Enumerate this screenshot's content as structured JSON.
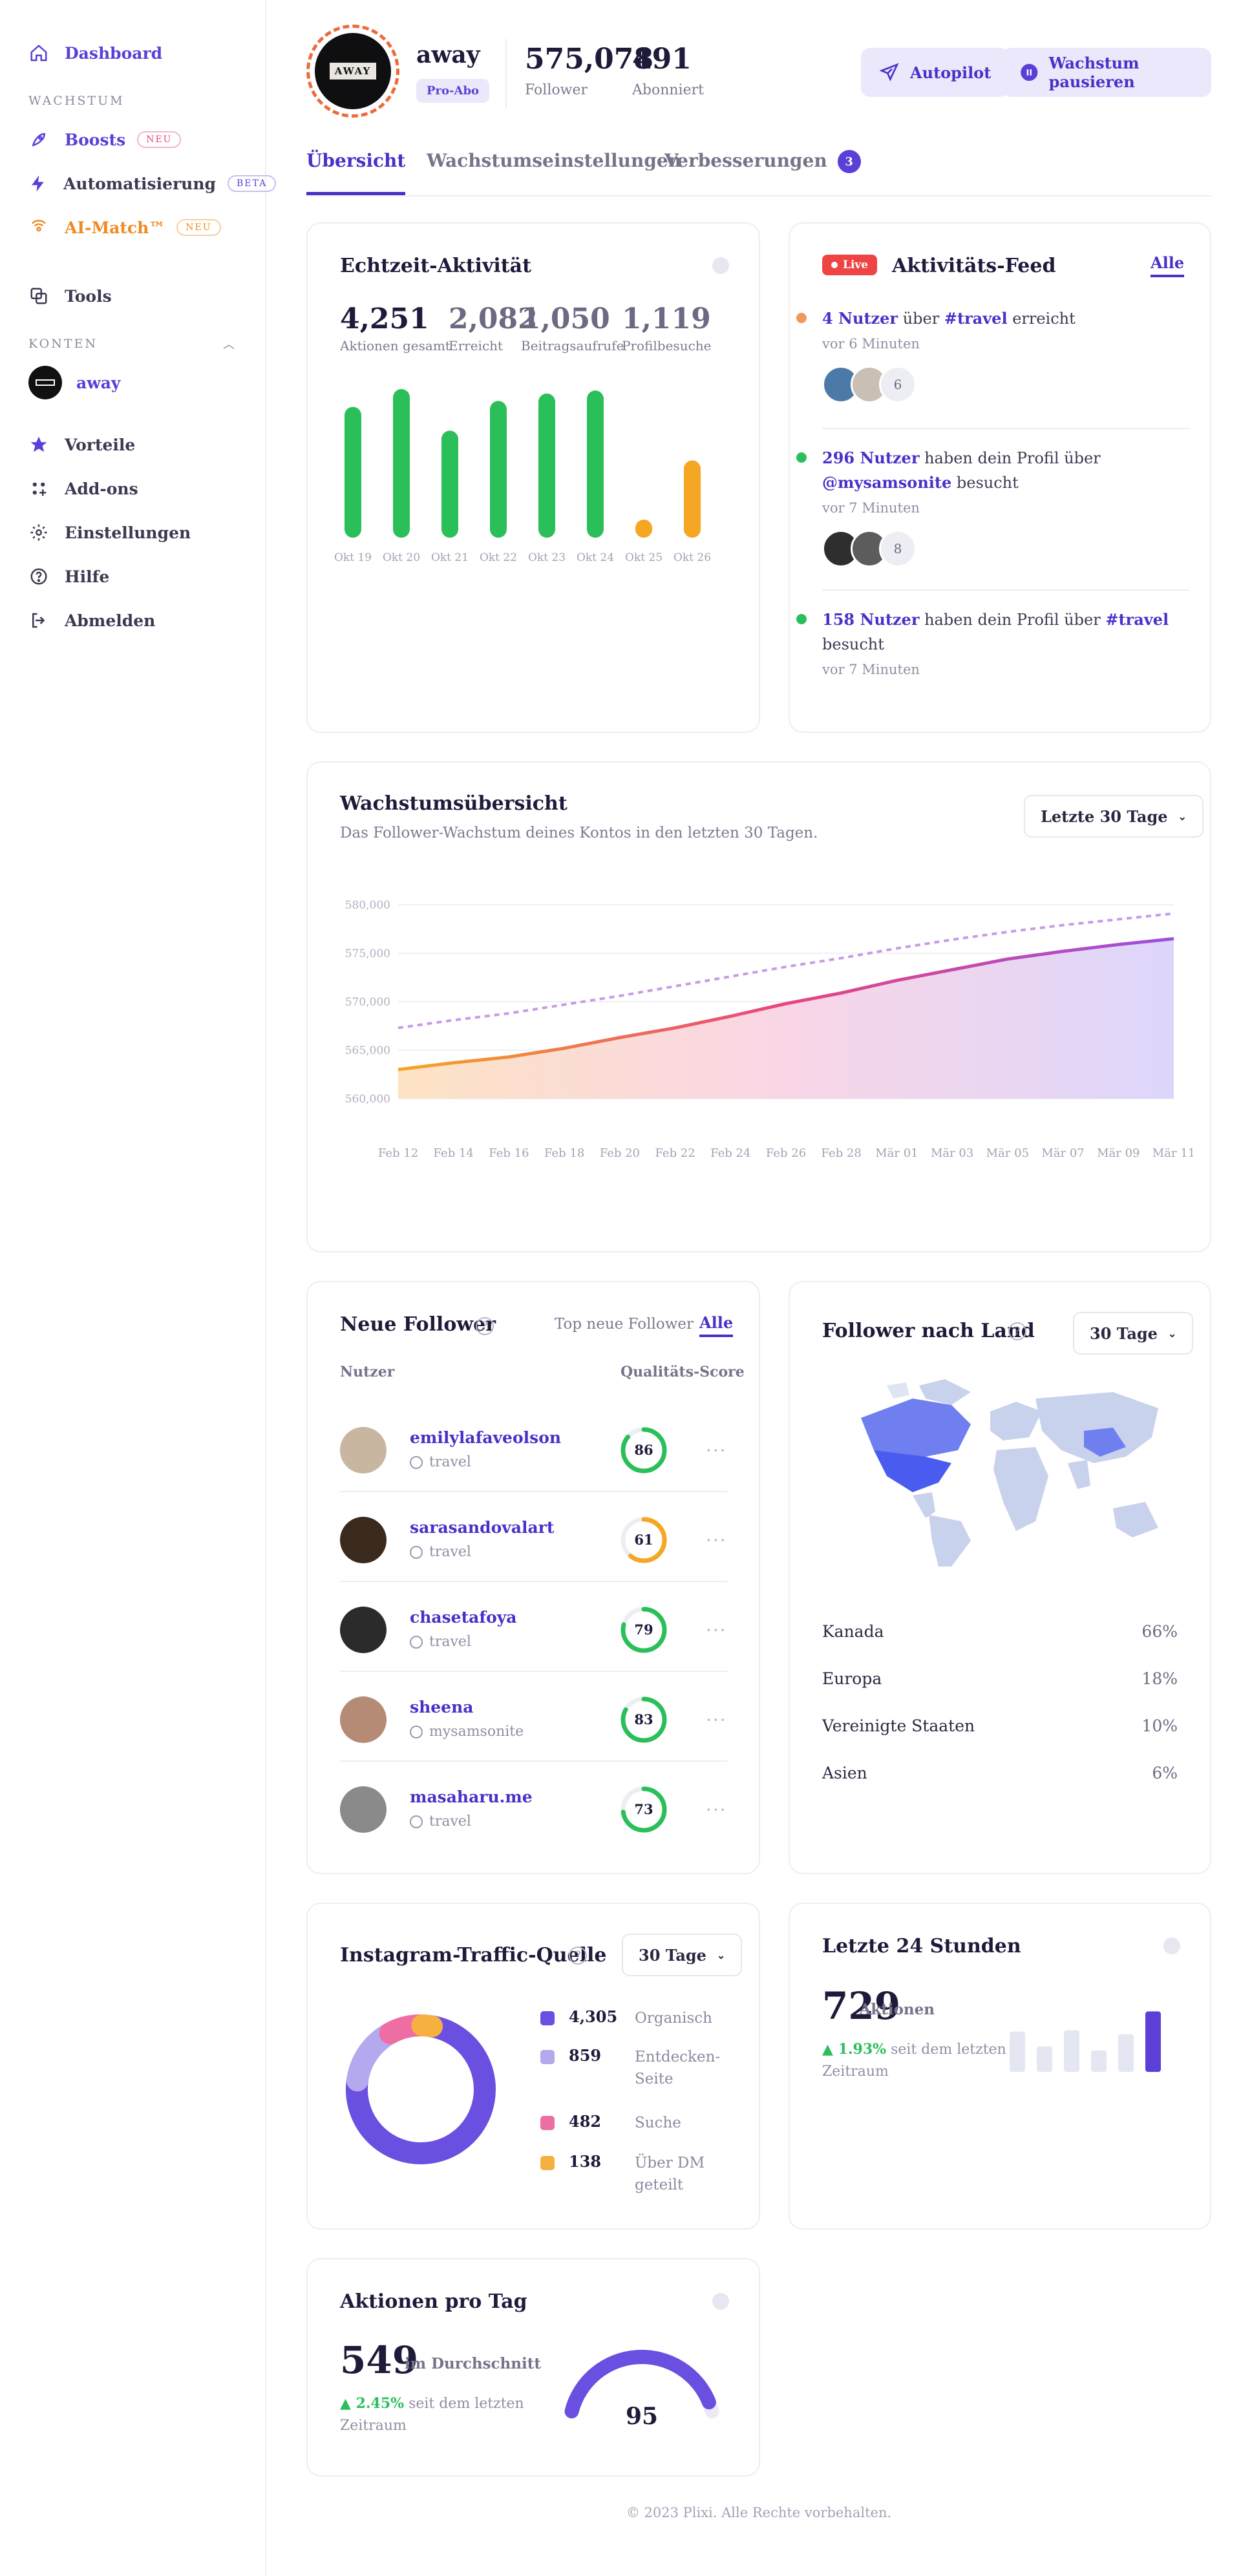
{
  "sidebar": {
    "dashboard": "Dashboard",
    "section_growth": "WACHSTUM",
    "boosts": "Boosts",
    "boosts_badge": "NEU",
    "automation": "Automatisierung",
    "automation_badge": "BETA",
    "aimatch": "AI-Match™",
    "aimatch_badge": "NEU",
    "tools": "Tools",
    "section_accounts": "KONTEN",
    "account_name": "away",
    "perks": "Vorteile",
    "addons": "Add-ons",
    "settings": "Einstellungen",
    "help": "Hilfe",
    "logout": "Abmelden"
  },
  "profile": {
    "avatar_logo": "AWAY",
    "name": "away",
    "plan": "Pro-Abo",
    "followers": "575,078",
    "followers_label": "Follower",
    "following": "491",
    "following_label": "Abonniert",
    "autopilot": "Autopilot",
    "pause": "Wachstum pausieren"
  },
  "tabs": {
    "overview": "Übersicht",
    "growth_settings": "Wachstumseinstellungen",
    "improvements": "Verbesserungen",
    "improvements_count": "3"
  },
  "realtime": {
    "title": "Echtzeit-Aktivität",
    "stats": [
      {
        "value": "4,251",
        "label": "Aktionen gesamt"
      },
      {
        "value": "2,082",
        "label": "Erreicht"
      },
      {
        "value": "1,050",
        "label": "Beitragsaufrufe"
      },
      {
        "value": "1,119",
        "label": "Profilbesuche"
      }
    ],
    "chart_data": {
      "type": "bar",
      "categories": [
        "Okt 19",
        "Okt 20",
        "Okt 21",
        "Okt 22",
        "Okt 23",
        "Okt 24",
        "Okt 25",
        "Okt 26"
      ],
      "values": [
        88,
        100,
        72,
        92,
        97,
        99,
        12,
        52
      ],
      "colors": [
        "#2bbf5a",
        "#2bbf5a",
        "#2bbf5a",
        "#2bbf5a",
        "#2bbf5a",
        "#2bbf5a",
        "#f5a623",
        "#f5a623"
      ],
      "ylim": [
        0,
        100
      ]
    }
  },
  "feed": {
    "live": "Live",
    "title": "Aktivitäts-Feed",
    "all": "Alle",
    "items": [
      {
        "a": "4 Nutzer",
        "b": " über ",
        "c": "#travel",
        "d": " erreicht",
        "time": "vor 6 Minuten",
        "more": "6"
      },
      {
        "a": "296 Nutzer",
        "b": " haben dein Profil über ",
        "c": "@mysamsonite",
        "d": " besucht",
        "time": "vor 7 Minuten",
        "more": "8"
      },
      {
        "a": "158 Nutzer",
        "b": " haben dein Profil über ",
        "c": "#travel",
        "d": " besucht",
        "time": "vor 7 Minuten"
      }
    ]
  },
  "growth": {
    "title": "Wachstumsübersicht",
    "subtitle": "Das Follower-Wachstum deines Kontos in den letzten 30 Tagen.",
    "range": "Letzte 30 Tage",
    "chart_data": {
      "type": "area",
      "x": [
        "Feb 12",
        "Feb 14",
        "Feb 16",
        "Feb 18",
        "Feb 20",
        "Feb 22",
        "Feb 24",
        "Feb 26",
        "Feb 28",
        "Mär 01",
        "Mär 03",
        "Mär 05",
        "Mär 07",
        "Mär 09",
        "Mär 11"
      ],
      "yticks": [
        "580,000",
        "575,000",
        "570,000",
        "565,000",
        "560,000"
      ],
      "ylim": [
        560000,
        580000
      ],
      "series": [
        {
          "values": [
            563000,
            563700,
            564300,
            565200,
            566300,
            567300,
            568500,
            569800,
            570900,
            572200,
            573300,
            574400,
            575200,
            575900,
            576500
          ]
        },
        {
          "values": [
            567300,
            568100,
            568800,
            569700,
            570600,
            571600,
            572600,
            573600,
            574500,
            575500,
            576400,
            577200,
            577900,
            578500,
            579100
          ]
        }
      ]
    }
  },
  "newfollowers": {
    "title": "Neue Follower",
    "tab_top": "Top neue Follower",
    "tab_all": "Alle",
    "col_user": "Nutzer",
    "col_score": "Qualitäts-Score",
    "rows": [
      {
        "name": "emilylafaveolson",
        "tag": "travel",
        "score": "86",
        "color": "#2bbf5a",
        "pct": 0.86,
        "ava": "#c8b6a0"
      },
      {
        "name": "sarasandovalart",
        "tag": "travel",
        "score": "61",
        "color": "#f5a623",
        "pct": 0.61,
        "ava": "#3a2a1e"
      },
      {
        "name": "chasetafoya",
        "tag": "travel",
        "score": "79",
        "color": "#2bbf5a",
        "pct": 0.79,
        "ava": "#2b2b2b"
      },
      {
        "name": "sheena",
        "tag": "mysamsonite",
        "score": "83",
        "color": "#2bbf5a",
        "pct": 0.83,
        "ava": "#b58b76"
      },
      {
        "name": "masaharu.me",
        "tag": "travel",
        "score": "73",
        "color": "#2bbf5a",
        "pct": 0.73,
        "ava": "#8a8a8a"
      }
    ]
  },
  "countries": {
    "title": "Follower nach Land",
    "range": "30 Tage",
    "rows": [
      {
        "name": "Kanada",
        "pct": "66%"
      },
      {
        "name": "Europa",
        "pct": "18%"
      },
      {
        "name": "Vereinigte Staaten",
        "pct": "10%"
      },
      {
        "name": "Asien",
        "pct": "6%"
      }
    ]
  },
  "traffic": {
    "title": "Instagram-Traffic-Quelle",
    "range": "30 Tage",
    "chart_data": {
      "type": "pie",
      "series": [
        {
          "name": "Organisch",
          "value": 4305,
          "label": "4,305",
          "color": "#6a4fe0"
        },
        {
          "name": "Entdecken-Seite",
          "value": 859,
          "label": "859",
          "color": "#b4a8ee"
        },
        {
          "name": "Suche",
          "value": 482,
          "label": "482",
          "color": "#ee6ea4"
        },
        {
          "name": "Über DM geteilt",
          "value": 138,
          "label": "138",
          "color": "#f5b03f"
        }
      ]
    }
  },
  "last24": {
    "title": "Letzte 24 Stunden",
    "value": "729",
    "unit": "Aktionen",
    "change": "▲ 1.93%",
    "change_text": " seit dem letzten Zeitraum",
    "chart_data": {
      "type": "bar",
      "values": [
        60,
        38,
        62,
        32,
        56,
        90
      ],
      "colors": [
        "#e4e6f2",
        "#e4e6f2",
        "#e4e6f2",
        "#e4e6f2",
        "#e4e6f2",
        "#5b3fd6"
      ],
      "ylim": [
        0,
        100
      ]
    }
  },
  "perday": {
    "title": "Aktionen pro Tag",
    "value": "549",
    "unit": "im Durchschnitt",
    "change": "▲ 2.45%",
    "change_text": " seit dem letzten Zeitraum",
    "gauge": "95",
    "gauge_value": 0.95
  },
  "footer": "© 2023 Plixi. Alle Rechte vorbehalten."
}
